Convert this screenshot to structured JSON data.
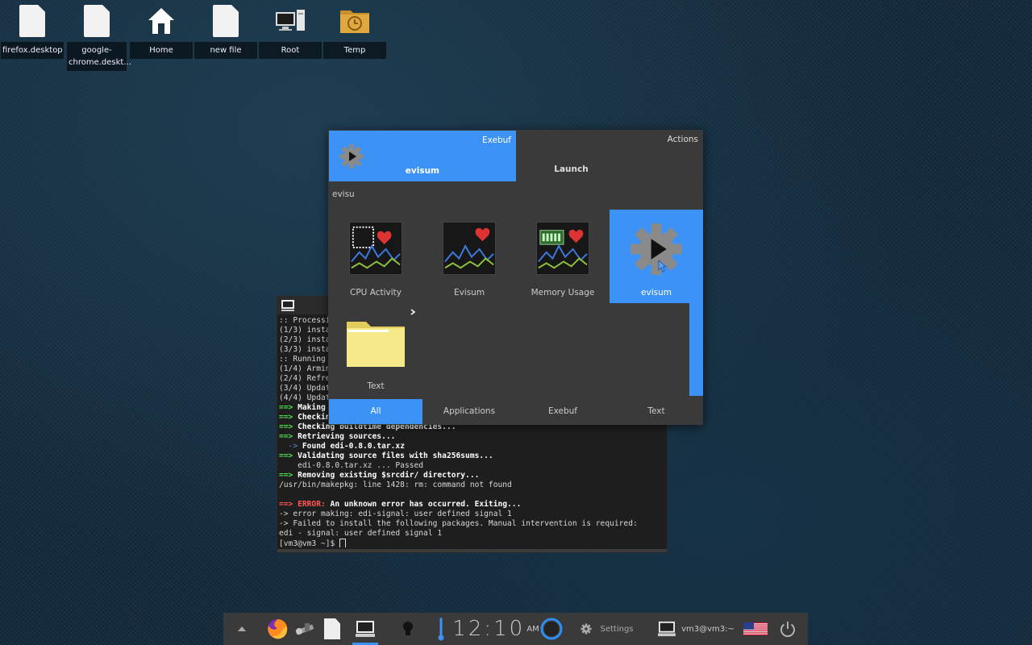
{
  "desktop": {
    "icons": [
      {
        "label": "firefox.desktop",
        "icon": "file-icon"
      },
      {
        "label": "google-chrome.deskt...",
        "icon": "file-icon"
      },
      {
        "label": "Home",
        "icon": "home-icon"
      },
      {
        "label": "new file",
        "icon": "file-icon"
      },
      {
        "label": "Root",
        "icon": "computer-icon"
      },
      {
        "label": "Temp",
        "icon": "folder-clock-icon"
      }
    ]
  },
  "launcher": {
    "selected_name": "evisum",
    "selected_category": "Exebuf",
    "actions_label": "Actions",
    "launch_label": "Launch",
    "query": "evisu",
    "items": [
      {
        "label": "CPU Activity"
      },
      {
        "label": "Evisum"
      },
      {
        "label": "Memory Usage"
      },
      {
        "label": "evisum"
      },
      {
        "label": "Text"
      }
    ],
    "tabs": [
      "All",
      "Applications",
      "Exebuf",
      "Text"
    ],
    "active_tab": "All",
    "accent": "#3d92f5"
  },
  "terminal": {
    "lines": [
      ":: Processi",
      "(1/3) insta",
      "(2/3) insta",
      "(3/3) insta",
      ":: Running",
      "(1/4) Armin",
      "(2/4) Refre",
      "(3/4) Updat",
      "(4/4) Updat",
      "Making",
      "Checkin",
      "Checking buildtime dependencies...",
      "Retrieving sources...",
      "Found edi-0.8.0.tar.xz",
      "Validating source files with sha256sums...",
      "edi-0.8.0.tar.xz ... Passed",
      "Removing existing $srcdir/ directory...",
      "/usr/bin/makepkg: line 1428: rm: command not found",
      "ERROR:",
      "An unknown error has occurred. Exiting...",
      "-> error making: edi-signal: user defined signal 1",
      "-> Failed to install the following packages. Manual intervention is required:",
      "edi - signal: user defined signal 1",
      "[vm3@vm3 ~]$"
    ],
    "arrow_main": "==>",
    "arrow_sub": "->"
  },
  "taskbar": {
    "clock": "12:10",
    "ampm": "AM",
    "settings_label": "Settings",
    "terminal_label": "vm3@vm3:~"
  }
}
